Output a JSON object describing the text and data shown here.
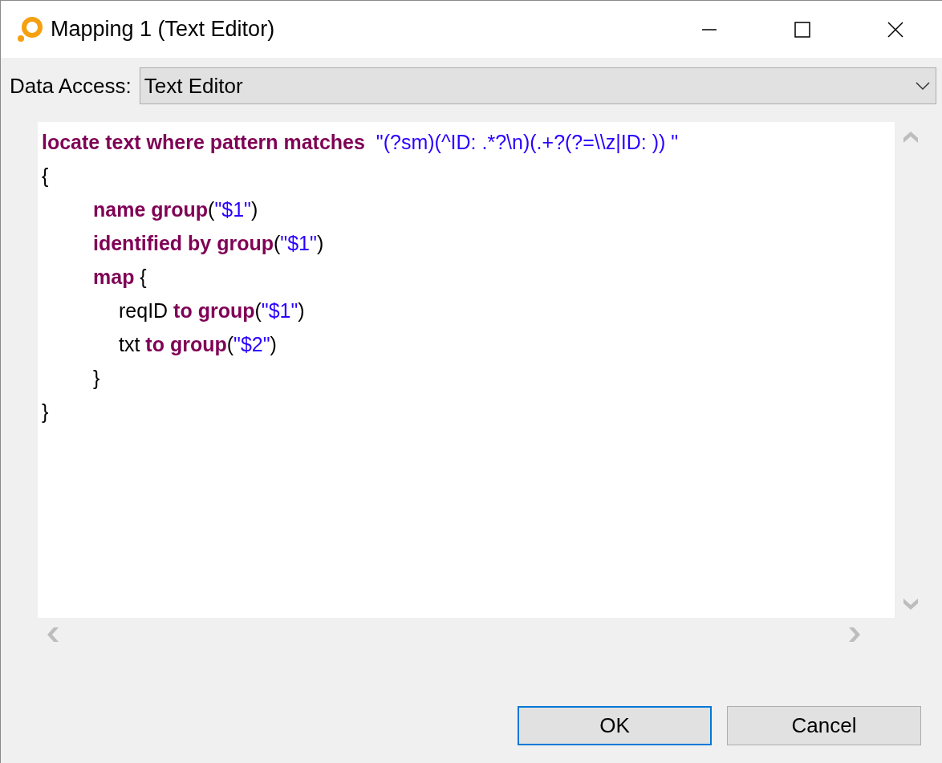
{
  "window": {
    "title": "Mapping 1 (Text Editor)"
  },
  "data_access": {
    "label": "Data Access:",
    "value": "Text Editor"
  },
  "editor": {
    "lines": [
      {
        "tokens": [
          {
            "kind": "keyword",
            "text": "locate text where pattern matches"
          },
          {
            "kind": "string",
            "text": "  \"(?sm)(^ID: .*?\\n)(.+?(?=\\\\z|ID: )) \""
          }
        ]
      },
      {
        "tokens": [
          {
            "kind": "plain",
            "text": "{"
          }
        ],
        "children": [
          {
            "tokens": [
              {
                "kind": "keyword",
                "text": "name group"
              },
              {
                "kind": "plain",
                "text": "("
              },
              {
                "kind": "string",
                "text": "\"$1\""
              },
              {
                "kind": "plain",
                "text": ")"
              }
            ]
          },
          {
            "tokens": [
              {
                "kind": "keyword",
                "text": "identified by group"
              },
              {
                "kind": "plain",
                "text": "("
              },
              {
                "kind": "string",
                "text": "\"$1\""
              },
              {
                "kind": "plain",
                "text": ")"
              }
            ]
          },
          {
            "tokens": [
              {
                "kind": "keyword",
                "text": "map"
              },
              {
                "kind": "plain",
                "text": " {"
              }
            ],
            "children": [
              {
                "tokens": [
                  {
                    "kind": "plain",
                    "text": "reqID "
                  },
                  {
                    "kind": "keyword",
                    "text": "to group"
                  },
                  {
                    "kind": "plain",
                    "text": "("
                  },
                  {
                    "kind": "string",
                    "text": "\"$1\""
                  },
                  {
                    "kind": "plain",
                    "text": ")"
                  }
                ]
              },
              {
                "tokens": [
                  {
                    "kind": "plain",
                    "text": "txt "
                  },
                  {
                    "kind": "keyword",
                    "text": "to group"
                  },
                  {
                    "kind": "plain",
                    "text": "("
                  },
                  {
                    "kind": "string",
                    "text": "\"$2\""
                  },
                  {
                    "kind": "plain",
                    "text": ")"
                  }
                ]
              }
            ]
          },
          {
            "tokens": [
              {
                "kind": "plain",
                "text": "}"
              }
            ]
          }
        ]
      },
      {
        "tokens": [
          {
            "kind": "plain",
            "text": "}"
          }
        ]
      }
    ]
  },
  "buttons": [
    {
      "label": "OK",
      "default": true
    },
    {
      "label": "Cancel",
      "default": false
    }
  ]
}
